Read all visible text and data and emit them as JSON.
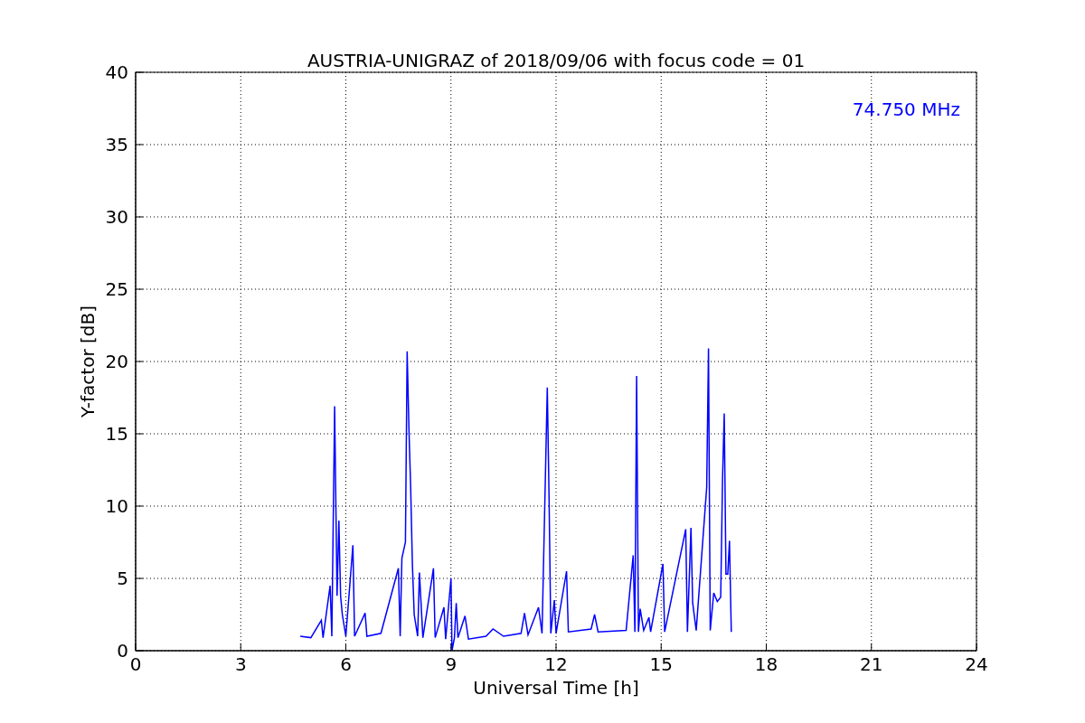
{
  "figure": {
    "chart_data": {
      "type": "line",
      "title": "AUSTRIA-UNIGRAZ of 2018/09/06 with focus code = 01",
      "xlabel": "Universal Time [h]",
      "ylabel": "Y-factor [dB]",
      "xlim": [
        0,
        24
      ],
      "ylim": [
        0,
        40
      ],
      "xticks": [
        0,
        3,
        6,
        9,
        12,
        15,
        18,
        21,
        24
      ],
      "yticks": [
        0,
        5,
        10,
        15,
        20,
        25,
        30,
        35,
        40
      ],
      "x": [
        4.7,
        5.0,
        5.3,
        5.35,
        5.55,
        5.6,
        5.68,
        5.72,
        5.75,
        5.8,
        5.85,
        5.9,
        6.0,
        6.2,
        6.25,
        6.55,
        6.6,
        7.0,
        7.5,
        7.55,
        7.6,
        7.7,
        7.75,
        7.8,
        7.85,
        7.9,
        7.95,
        8.05,
        8.1,
        8.2,
        8.5,
        8.55,
        8.8,
        8.85,
        9.0,
        9.03,
        9.1,
        9.15,
        9.2,
        9.4,
        9.5,
        10.0,
        10.2,
        10.5,
        11.0,
        11.1,
        11.2,
        11.5,
        11.6,
        11.75,
        11.8,
        11.85,
        11.95,
        12.0,
        12.3,
        12.35,
        13.0,
        13.1,
        13.2,
        14.0,
        14.2,
        14.25,
        14.3,
        14.35,
        14.4,
        14.5,
        14.65,
        14.7,
        15.05,
        15.1,
        15.7,
        15.75,
        15.85,
        15.9,
        16.0,
        16.3,
        16.35,
        16.4,
        16.5,
        16.6,
        16.7,
        16.75,
        16.8,
        16.85,
        16.9,
        16.95,
        17.0
      ],
      "series": [
        {
          "name": "74.750 MHz",
          "color": "#0000ff",
          "values": [
            1.0,
            0.9,
            2.1,
            0.9,
            4.5,
            1.0,
            16.9,
            9.5,
            3.8,
            9.0,
            3.8,
            2.5,
            1.0,
            7.3,
            1.0,
            2.6,
            1.0,
            1.2,
            5.7,
            1.0,
            6.4,
            7.5,
            20.7,
            15.3,
            11.3,
            6.0,
            2.5,
            1.0,
            5.4,
            0.9,
            5.7,
            0.9,
            3.0,
            0.8,
            5.0,
            0.0,
            0.9,
            3.3,
            0.9,
            2.4,
            0.8,
            1.0,
            1.5,
            1.0,
            1.2,
            2.6,
            1.1,
            3.0,
            1.2,
            18.2,
            10.4,
            1.2,
            3.5,
            1.2,
            5.5,
            1.3,
            1.5,
            2.5,
            1.3,
            1.4,
            6.6,
            1.3,
            19.0,
            1.3,
            2.9,
            1.4,
            2.3,
            1.3,
            6.0,
            1.3,
            8.4,
            1.3,
            8.5,
            3.3,
            1.4,
            11.3,
            20.9,
            1.4,
            4.0,
            3.4,
            3.7,
            11.8,
            16.4,
            5.3,
            5.3,
            7.6,
            1.3
          ]
        }
      ],
      "grid": true
    }
  }
}
